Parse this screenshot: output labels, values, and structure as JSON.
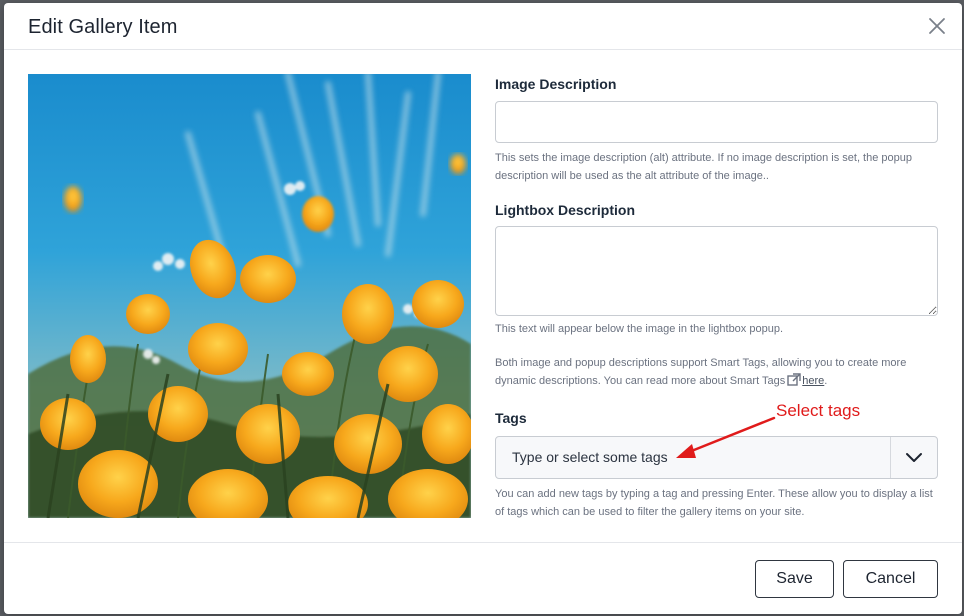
{
  "modal": {
    "title": "Edit Gallery Item"
  },
  "image": {
    "subject": "orange-poppy-flowers-photo",
    "colors": {
      "sky": "#1e8fcf",
      "petal": "#f6a81c",
      "stem": "#3f5a2c"
    }
  },
  "image_description": {
    "label": "Image Description",
    "value": "",
    "help": "This sets the image description (alt) attribute. If no image description is set, the popup description will be used as the alt attribute of the image.."
  },
  "lightbox_description": {
    "label": "Lightbox Description",
    "value": "",
    "help": "This text will appear below the image in the lightbox popup."
  },
  "smart_tags": {
    "help_text": "Both image and popup descriptions support Smart Tags, allowing you to create more dynamic descriptions. You can read more about Smart Tags",
    "link_text": "here",
    "suffix": "."
  },
  "tags": {
    "label": "Tags",
    "placeholder": "Type or select some tags",
    "help": "You can add new tags by typing a tag and pressing Enter. These allow you to display a list of tags which can be used to filter the gallery items on your site."
  },
  "annotation": {
    "text": "Select tags",
    "color": "#e01b1b"
  },
  "footer": {
    "save_label": "Save",
    "cancel_label": "Cancel"
  }
}
